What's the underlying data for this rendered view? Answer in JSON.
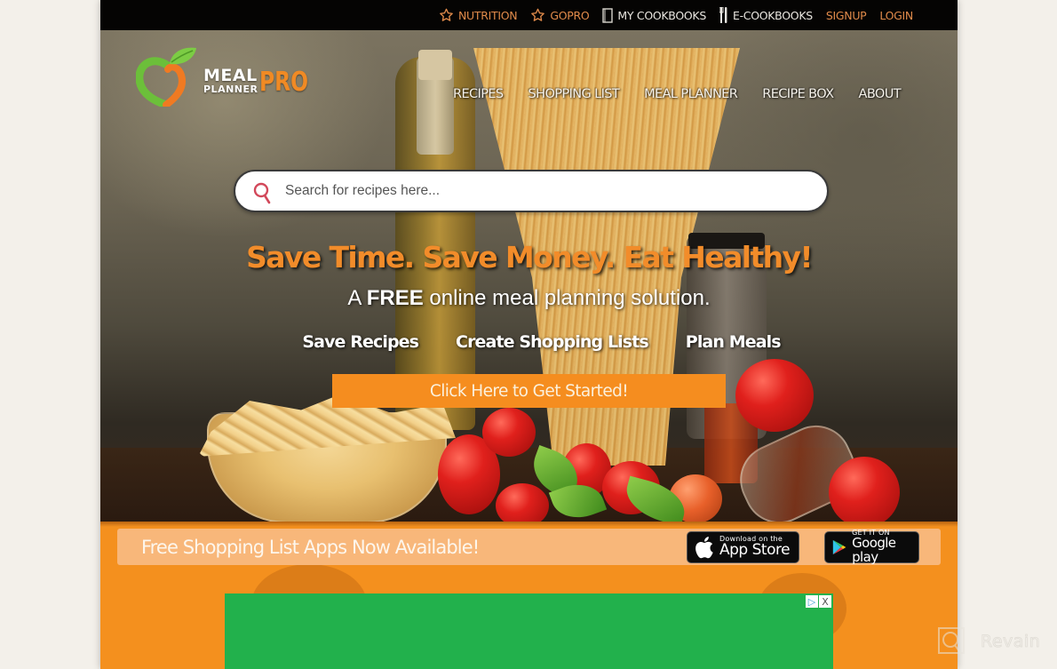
{
  "topbar": {
    "links": [
      {
        "label": "NUTRITION",
        "icon": "star-icon",
        "color": "#e08a4a"
      },
      {
        "label": "GOPRO",
        "icon": "star-icon",
        "color": "#e08a4a"
      },
      {
        "label": "MY COOKBOOKS",
        "icon": "book-icon",
        "color": "#e9e6e0"
      },
      {
        "label": "E-COOKBOOKS",
        "icon": "utensils-icon",
        "color": "#e9e6e0"
      },
      {
        "label": "SIGNUP",
        "color": "#e08a4a"
      },
      {
        "label": "LOGIN",
        "color": "#e08a4a"
      }
    ]
  },
  "logo": {
    "line1": "MEAL",
    "line2": "PLANNER",
    "pro": "PRO"
  },
  "nav": {
    "items": [
      "RECIPES",
      "SHOPPING LIST",
      "MEAL PLANNER",
      "RECIPE BOX",
      "ABOUT"
    ]
  },
  "search": {
    "placeholder": "Search for recipes here...",
    "value": ""
  },
  "hero": {
    "headline": "Save Time. Save Money. Eat Healthy!",
    "subline_prefix": "A ",
    "subline_bold": "FREE",
    "subline_suffix": " online meal planning solution.",
    "features": [
      "Save Recipes",
      "Create Shopping Lists",
      "Plan Meals"
    ],
    "cta_label": "Click Here to Get Started!"
  },
  "apps": {
    "text": "Free Shopping List Apps Now Available!",
    "apple": {
      "small": "Download on the",
      "big": "App Store"
    },
    "google": {
      "small": "GET IT ON",
      "big": "Google play"
    }
  },
  "ad": {
    "adchoices_glyph": "▷",
    "close_glyph": "X"
  },
  "watermark": {
    "text": "Revain"
  },
  "colors": {
    "brand_orange": "#f58d1f",
    "topbar_bg": "#050403",
    "ad_green": "#22b14c",
    "apps_bar": "#f8b77a"
  }
}
